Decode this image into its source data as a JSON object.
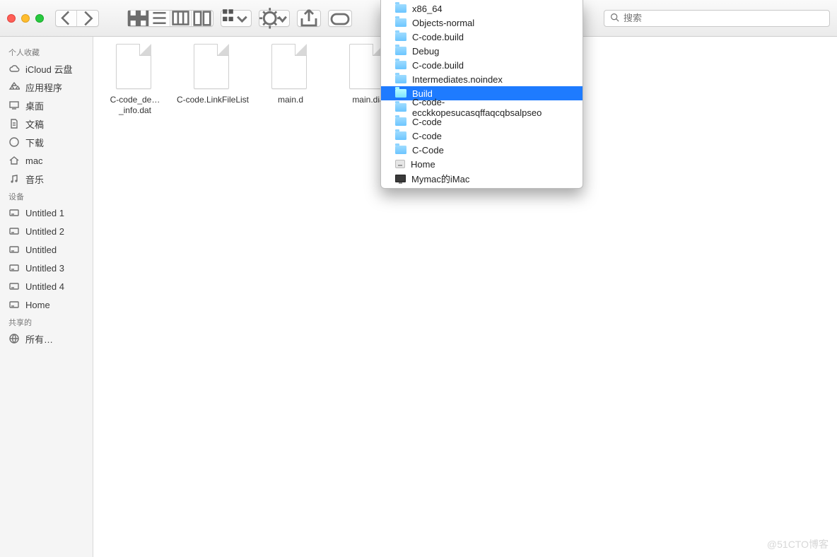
{
  "search": {
    "placeholder": "搜索"
  },
  "sidebar": {
    "sections": [
      {
        "header": "个人收藏",
        "items": [
          {
            "icon": "cloud-icon",
            "label": "iCloud 云盘"
          },
          {
            "icon": "apps-icon",
            "label": "应用程序"
          },
          {
            "icon": "desktop-icon",
            "label": "桌面"
          },
          {
            "icon": "docs-icon",
            "label": "文稿"
          },
          {
            "icon": "download-icon",
            "label": "下载"
          },
          {
            "icon": "home-icon",
            "label": "mac"
          },
          {
            "icon": "music-icon",
            "label": "音乐"
          }
        ]
      },
      {
        "header": "设备",
        "items": [
          {
            "icon": "disk-icon",
            "label": "Untitled 1"
          },
          {
            "icon": "disk-icon",
            "label": "Untitled 2"
          },
          {
            "icon": "disk-icon",
            "label": "Untitled"
          },
          {
            "icon": "disk-icon",
            "label": "Untitled 3"
          },
          {
            "icon": "disk-icon",
            "label": "Untitled 4"
          },
          {
            "icon": "disk-icon",
            "label": "Home"
          }
        ]
      },
      {
        "header": "共享的",
        "items": [
          {
            "icon": "network-icon",
            "label": "所有…"
          }
        ]
      }
    ]
  },
  "files": [
    {
      "name": "C-code_de…_info.dat"
    },
    {
      "name": "C-code.LinkFileList"
    },
    {
      "name": "main.d"
    },
    {
      "name": "main.dia"
    }
  ],
  "path_menu": {
    "items": [
      {
        "label": "x86_64",
        "icon": "folder",
        "depth": 0,
        "selected": false
      },
      {
        "label": "Objects-normal",
        "icon": "folder",
        "depth": 0,
        "selected": false
      },
      {
        "label": "C-code.build",
        "icon": "folder",
        "depth": 0,
        "selected": false
      },
      {
        "label": "Debug",
        "icon": "folder",
        "depth": 0,
        "selected": false
      },
      {
        "label": "C-code.build",
        "icon": "folder",
        "depth": 0,
        "selected": false
      },
      {
        "label": "Intermediates.noindex",
        "icon": "folder",
        "depth": 0,
        "selected": false
      },
      {
        "label": "Build",
        "icon": "folder",
        "depth": 1,
        "selected": true
      },
      {
        "label": "C-code-ecckkopesucasqffaqcqbsalpseo",
        "icon": "folder",
        "depth": 1,
        "selected": false
      },
      {
        "label": "C-code",
        "icon": "folder",
        "depth": 1,
        "selected": false
      },
      {
        "label": "C-code",
        "icon": "folder",
        "depth": 1,
        "selected": false
      },
      {
        "label": "C-Code",
        "icon": "folder",
        "depth": 1,
        "selected": false
      },
      {
        "label": "Home",
        "icon": "disk",
        "depth": 1,
        "selected": false
      },
      {
        "label": "Mymac的iMac",
        "icon": "monitor",
        "depth": 1,
        "selected": false
      }
    ]
  },
  "watermark": "@51CTO博客"
}
